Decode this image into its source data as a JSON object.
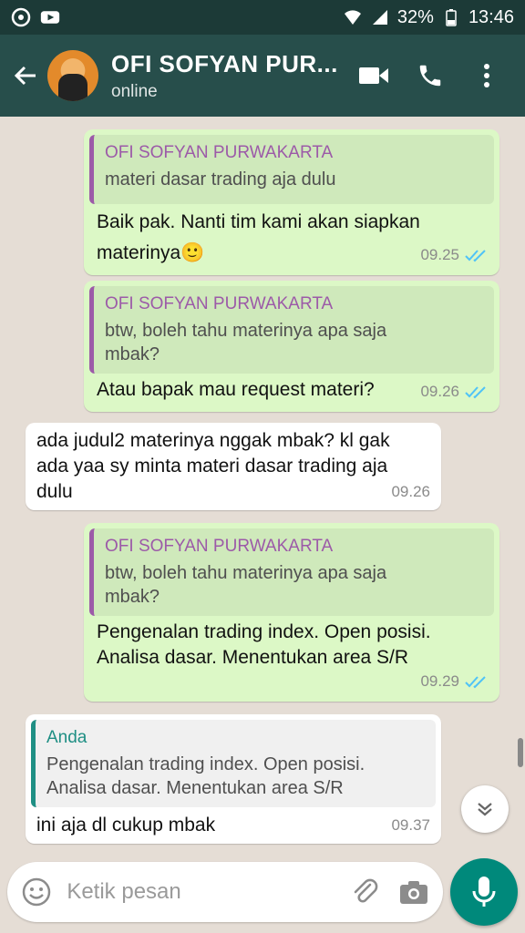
{
  "status_bar": {
    "battery": "32%",
    "time": "13:46"
  },
  "header": {
    "contact_name": "OFI SOFYAN PUR...",
    "status": "online"
  },
  "messages": [
    {
      "quote_author": "OFI SOFYAN PURWAKARTA",
      "quote_text": "materi dasar trading aja dulu",
      "text_line1": "Baik pak. Nanti tim kami akan siapkan",
      "text_line2": "materinya🙂",
      "time": "09.25"
    },
    {
      "quote_author": "OFI SOFYAN PURWAKARTA",
      "quote_line1": "btw, boleh tahu materinya apa saja",
      "quote_line2": "mbak?",
      "text": "Atau bapak mau request materi?",
      "time": "09.26"
    },
    {
      "line1": "ada judul2 materinya nggak mbak? kl gak",
      "line2": "ada yaa sy minta materi dasar trading aja",
      "line3": "dulu",
      "time": "09.26"
    },
    {
      "quote_author": "OFI SOFYAN PURWAKARTA",
      "quote_line1": "btw, boleh tahu materinya apa saja",
      "quote_line2": "mbak?",
      "text_line1": "Pengenalan trading index. Open posisi.",
      "text_line2": "Analisa dasar. Menentukan area S/R",
      "time": "09.29"
    },
    {
      "quote_author": "Anda",
      "quote_line1": "Pengenalan trading index. Open posisi.",
      "quote_line2": "Analisa dasar. Menentukan area S/R",
      "text": "ini aja dl cukup mbak",
      "time": "09.37"
    }
  ],
  "composer": {
    "placeholder": "Ketik pesan"
  },
  "colors": {
    "header": "#274e4b",
    "status_bar": "#1c3a37",
    "outgoing_bubble": "#dcf8c6",
    "incoming_bubble": "#ffffff",
    "quote_author_other": "#9c5aa8",
    "quote_author_self": "#1f8f84",
    "read_ticks": "#4fc3f7",
    "mic_button": "#00897b"
  }
}
